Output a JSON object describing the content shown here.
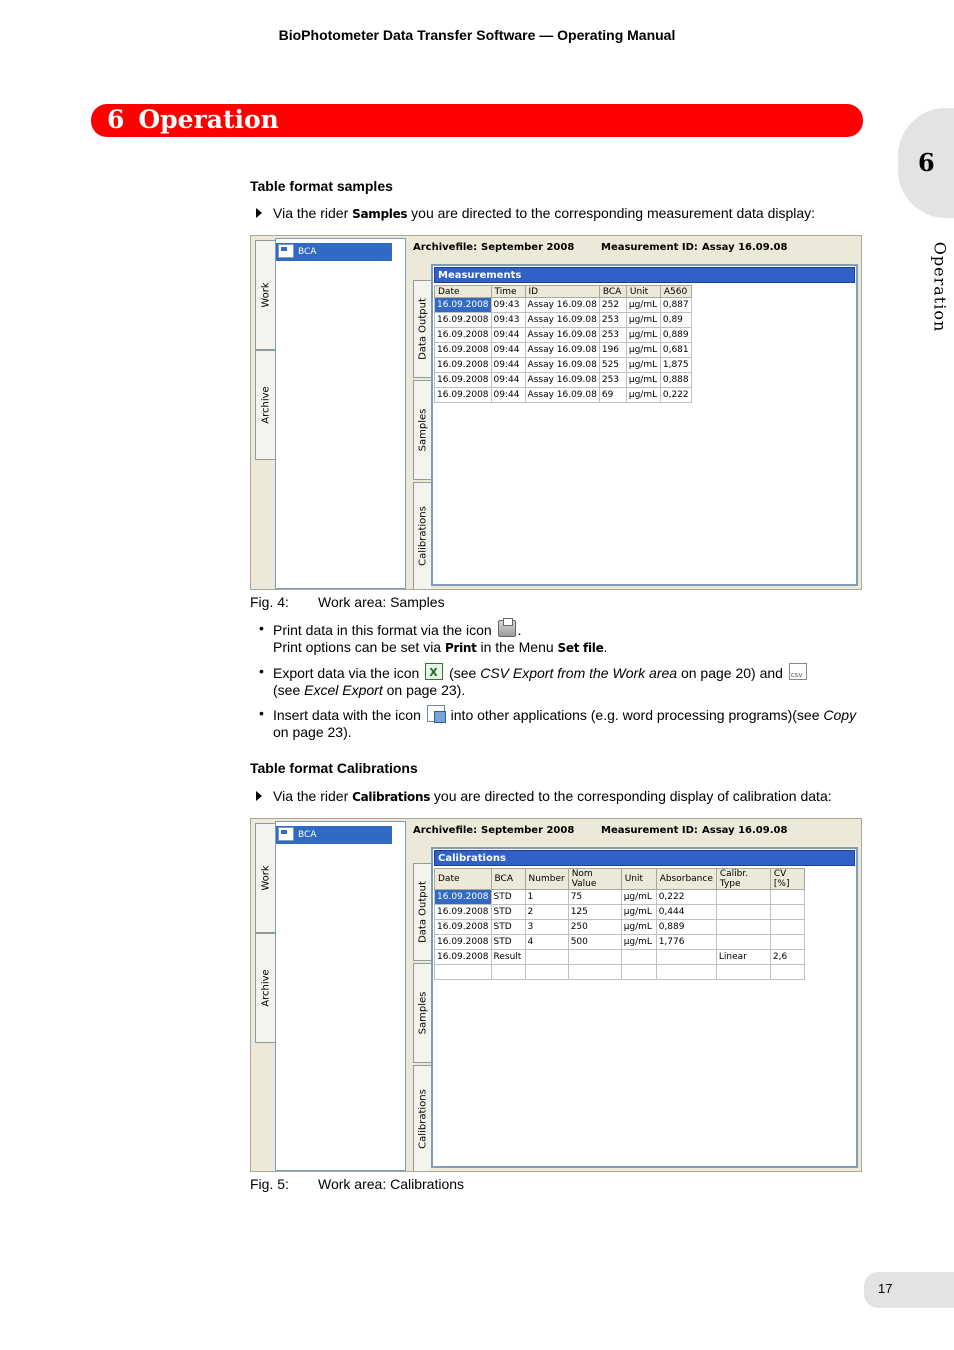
{
  "header": {
    "title": "BioPhotometer Data Transfer Software  —  Operating Manual"
  },
  "chapter": {
    "number": "6",
    "title": "Operation"
  },
  "side_tab": {
    "number": "6",
    "label": "Operation"
  },
  "page_number": "17",
  "section1": {
    "heading": "Table format samples",
    "instruction_pre": "Via the rider ",
    "instruction_rider": "Samples",
    "instruction_post": " you are directed to the corresponding measurement data display:"
  },
  "figure4": {
    "left_tabs": [
      "Work",
      "Archive"
    ],
    "tree_item": "BCA",
    "archivefile_label": "Archivefile:",
    "archivefile_value": "September 2008",
    "measurement_label": "Measurement ID:",
    "measurement_value": "Assay 16.09.08",
    "inner_tabs": [
      "Data Output",
      "Samples",
      "Calibrations"
    ],
    "grid_title": "Measurements",
    "columns": [
      "Date",
      "Time",
      "ID",
      "BCA",
      "Unit",
      "A560"
    ],
    "rows": [
      [
        "16.09.2008",
        "09:43",
        "Assay 16.09.08",
        "252",
        "µg/mL",
        "0,887"
      ],
      [
        "16.09.2008",
        "09:43",
        "Assay 16.09.08",
        "253",
        "µg/mL",
        "0,89"
      ],
      [
        "16.09.2008",
        "09:44",
        "Assay 16.09.08",
        "253",
        "µg/mL",
        "0,889"
      ],
      [
        "16.09.2008",
        "09:44",
        "Assay 16.09.08",
        "196",
        "µg/mL",
        "0,681"
      ],
      [
        "16.09.2008",
        "09:44",
        "Assay 16.09.08",
        "525",
        "µg/mL",
        "1,875"
      ],
      [
        "16.09.2008",
        "09:44",
        "Assay 16.09.08",
        "253",
        "µg/mL",
        "0,888"
      ],
      [
        "16.09.2008",
        "09:44",
        "Assay 16.09.08",
        "69",
        "µg/mL",
        "0,222"
      ]
    ],
    "caption_number": "Fig. 4:",
    "caption_text": "Work area: Samples"
  },
  "bullets": {
    "print_pre": "Print data in this format via the icon",
    "print_post": ".",
    "print_options_pre": "Print options can be set via ",
    "print_options_print": "Print",
    "print_options_mid": " in the Menu ",
    "print_options_menu": "Set file",
    "print_options_post": ".",
    "export_pre": "Export data via the icon",
    "export_see1": " (see ",
    "export_link1": "CSV Export from the Work area",
    "export_page1": " on page 20) and ",
    "export_see2": "(see ",
    "export_link2": "Excel Export",
    "export_page2": " on page 23).",
    "insert_pre": "Insert data with the icon",
    "insert_post": " into other applications (e.g. word processing programs)(see ",
    "insert_link": "Copy",
    "insert_page": " on page 23)."
  },
  "section2": {
    "heading": "Table format Calibrations",
    "instruction_pre": "Via the rider ",
    "instruction_rider": "Calibrations",
    "instruction_post": " you are directed to the corresponding display of calibration data:"
  },
  "figure5": {
    "left_tabs": [
      "Work",
      "Archive"
    ],
    "tree_item": "BCA",
    "archivefile_label": "Archivefile:",
    "archivefile_value": "September 2008",
    "measurement_label": "Measurement ID:",
    "measurement_value": "Assay 16.09.08",
    "inner_tabs": [
      "Data Output",
      "Samples",
      "Calibrations"
    ],
    "grid_title": "Calibrations",
    "columns": [
      "Date",
      "BCA",
      "Number",
      "Nom Value",
      "Unit",
      "Absorbance",
      "Calibr. Type",
      "CV [%]"
    ],
    "rows": [
      [
        "16.09.2008",
        "STD",
        "1",
        "75",
        "µg/mL",
        "0,222",
        "",
        ""
      ],
      [
        "16.09.2008",
        "STD",
        "2",
        "125",
        "µg/mL",
        "0,444",
        "",
        ""
      ],
      [
        "16.09.2008",
        "STD",
        "3",
        "250",
        "µg/mL",
        "0,889",
        "",
        ""
      ],
      [
        "16.09.2008",
        "STD",
        "4",
        "500",
        "µg/mL",
        "1,776",
        "",
        ""
      ],
      [
        "16.09.2008",
        "Result",
        "",
        "",
        "",
        "",
        "Linear",
        "2,6"
      ],
      [
        "",
        "",
        "",
        "",
        "",
        "",
        "",
        ""
      ]
    ],
    "caption_number": "Fig. 5:",
    "caption_text": "Work area: Calibrations"
  }
}
